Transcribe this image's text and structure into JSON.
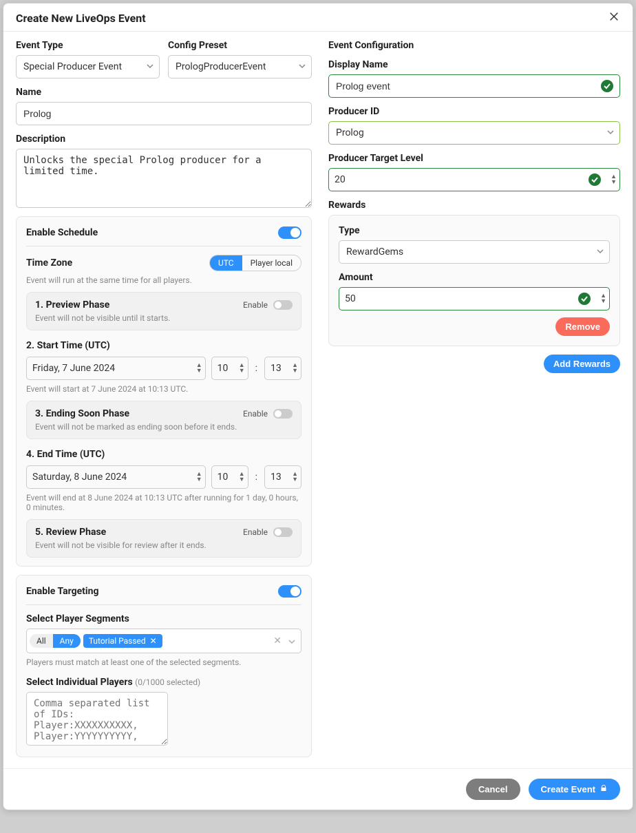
{
  "header": {
    "title": "Create New LiveOps Event"
  },
  "left": {
    "event_type": {
      "label": "Event Type",
      "value": "Special Producer Event"
    },
    "config_preset": {
      "label": "Config Preset",
      "value": "PrologProducerEvent"
    },
    "name": {
      "label": "Name",
      "value": "Prolog"
    },
    "description": {
      "label": "Description",
      "value": "Unlocks the special Prolog producer for a limited time."
    },
    "schedule_panel": {
      "title": "Enable Schedule",
      "tz_label": "Time Zone",
      "tz_hint": "Event will run at the same time for all players.",
      "tz_options": {
        "utc": "UTC",
        "local": "Player local"
      },
      "preview": {
        "title": "1. Preview Phase",
        "enable": "Enable",
        "desc": "Event will not be visible until it starts."
      },
      "start": {
        "title": "2. Start Time (UTC)",
        "date": "Friday, 7 June 2024",
        "hour": "10",
        "minute": "13",
        "hint": "Event will start at 7 June 2024 at 10:13 UTC."
      },
      "ending_soon": {
        "title": "3. Ending Soon Phase",
        "enable": "Enable",
        "desc": "Event will not be marked as ending soon before it ends."
      },
      "end": {
        "title": "4. End Time (UTC)",
        "date": "Saturday, 8 June 2024",
        "hour": "10",
        "minute": "13",
        "hint": "Event will end at 8 June 2024 at 10:13 UTC after running for 1 day, 0 hours, 0 minutes."
      },
      "review": {
        "title": "5. Review Phase",
        "enable": "Enable",
        "desc": "Event will not be visible for review after it ends."
      }
    },
    "targeting_panel": {
      "title": "Enable Targeting",
      "segments_label": "Select Player Segments",
      "all": "All",
      "any": "Any",
      "chip": "Tutorial Passed",
      "segments_hint": "Players must match at least one of the selected segments.",
      "individual_label": "Select Individual Players",
      "individual_note": "(0/1000 selected)",
      "individual_placeholder": "Comma separated list of IDs: Player:XXXXXXXXXX, Player:YYYYYYYYYY, ..."
    }
  },
  "right": {
    "title": "Event Configuration",
    "display_name": {
      "label": "Display Name",
      "value": "Prolog event"
    },
    "producer_id": {
      "label": "Producer ID",
      "value": "Prolog"
    },
    "target_level": {
      "label": "Producer Target Level",
      "value": "20"
    },
    "rewards_label": "Rewards",
    "reward": {
      "type_label": "Type",
      "type_value": "RewardGems",
      "amount_label": "Amount",
      "amount_value": "50",
      "remove": "Remove"
    },
    "add_rewards": "Add Rewards"
  },
  "footer": {
    "cancel": "Cancel",
    "create": "Create Event"
  }
}
